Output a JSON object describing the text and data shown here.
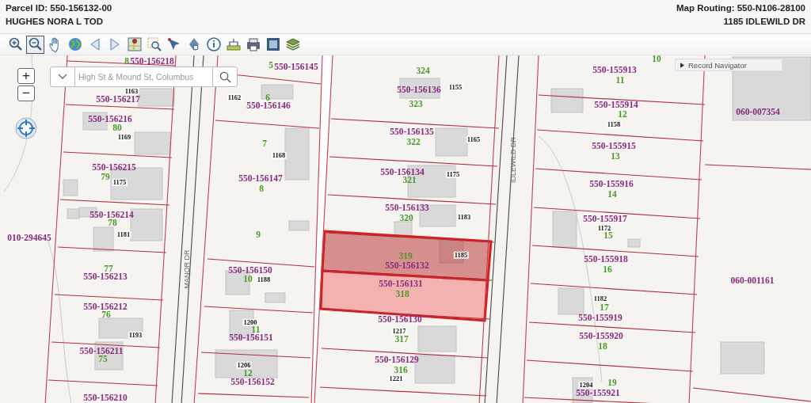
{
  "header": {
    "parcel_id": "Parcel ID: 550-156132-00",
    "owner": "HUGHES NORA L TOD",
    "map_routing": "Map Routing: 550-N106-28100",
    "address": "1185 IDLEWILD DR"
  },
  "toolbar": {
    "tools": [
      {
        "kind": "zoom-in",
        "selected": false
      },
      {
        "kind": "zoom-out",
        "selected": true
      },
      {
        "kind": "pan",
        "selected": false
      },
      {
        "kind": "globe",
        "selected": false
      },
      {
        "kind": "back",
        "selected": false
      },
      {
        "kind": "forward",
        "selected": false
      },
      {
        "kind": "map-pin",
        "selected": false
      },
      {
        "kind": "zoom-box",
        "selected": false
      },
      {
        "kind": "select",
        "selected": false
      },
      {
        "kind": "identify",
        "selected": false
      },
      {
        "kind": "info",
        "selected": false
      },
      {
        "kind": "measure",
        "selected": false
      },
      {
        "kind": "print",
        "selected": false
      },
      {
        "kind": "frame",
        "selected": false
      },
      {
        "kind": "layers",
        "selected": false
      }
    ]
  },
  "search": {
    "placeholder": "High St & Mound St, Columbus"
  },
  "zoom_controls": {
    "zoom_in": "+",
    "zoom_out": "−"
  },
  "record_navigator": {
    "label": "Record Navigator"
  },
  "map": {
    "labels": [
      {
        "kind": "lot",
        "text": "8"
      },
      {
        "kind": "parcel",
        "text": "550-156218"
      },
      {
        "kind": "lot",
        "text": "5"
      },
      {
        "kind": "parcel",
        "text": "550-156145"
      },
      {
        "kind": "house",
        "text": "1163"
      },
      {
        "kind": "parcel",
        "text": "550-156217"
      },
      {
        "kind": "house",
        "text": "1162"
      },
      {
        "kind": "lot",
        "text": "6"
      },
      {
        "kind": "parcel",
        "text": "550-156146"
      },
      {
        "kind": "parcel",
        "text": "550-156216"
      },
      {
        "kind": "lot",
        "text": "80"
      },
      {
        "kind": "house",
        "text": "1169"
      },
      {
        "kind": "lot",
        "text": "7"
      },
      {
        "kind": "house",
        "text": "1168"
      },
      {
        "kind": "parcel",
        "text": "550-156215"
      },
      {
        "kind": "lot",
        "text": "79"
      },
      {
        "kind": "house",
        "text": "1175"
      },
      {
        "kind": "parcel",
        "text": "550-156147"
      },
      {
        "kind": "lot",
        "text": "8"
      },
      {
        "kind": "parcel",
        "text": "550-156214"
      },
      {
        "kind": "lot",
        "text": "78"
      },
      {
        "kind": "house",
        "text": "1181"
      },
      {
        "kind": "parcel",
        "text": "010-294645"
      },
      {
        "kind": "lot",
        "text": "9"
      },
      {
        "kind": "lot",
        "text": "77"
      },
      {
        "kind": "parcel",
        "text": "550-156213"
      },
      {
        "kind": "parcel",
        "text": "550-156150"
      },
      {
        "kind": "lot",
        "text": "10"
      },
      {
        "kind": "house",
        "text": "1188"
      },
      {
        "kind": "parcel",
        "text": "550-156212"
      },
      {
        "kind": "lot",
        "text": "76"
      },
      {
        "kind": "house",
        "text": "1193"
      },
      {
        "kind": "house",
        "text": "1200"
      },
      {
        "kind": "lot",
        "text": "11"
      },
      {
        "kind": "parcel",
        "text": "550-156151"
      },
      {
        "kind": "parcel",
        "text": "550-156211"
      },
      {
        "kind": "lot",
        "text": "75"
      },
      {
        "kind": "house",
        "text": "1206"
      },
      {
        "kind": "lot",
        "text": "12"
      },
      {
        "kind": "parcel",
        "text": "550-156152"
      },
      {
        "kind": "parcel",
        "text": "550-156210"
      },
      {
        "kind": "street",
        "text": "MANOR DR"
      },
      {
        "kind": "lot",
        "text": "324"
      },
      {
        "kind": "parcel",
        "text": "550-156136"
      },
      {
        "kind": "house",
        "text": "1155"
      },
      {
        "kind": "lot",
        "text": "323"
      },
      {
        "kind": "parcel",
        "text": "550-156135"
      },
      {
        "kind": "lot",
        "text": "322"
      },
      {
        "kind": "house",
        "text": "1165"
      },
      {
        "kind": "parcel",
        "text": "550-156134"
      },
      {
        "kind": "lot",
        "text": "321"
      },
      {
        "kind": "house",
        "text": "1175"
      },
      {
        "kind": "parcel",
        "text": "550-156133"
      },
      {
        "kind": "lot",
        "text": "320"
      },
      {
        "kind": "house",
        "text": "1183"
      },
      {
        "kind": "lot",
        "text": "319"
      },
      {
        "kind": "parcel",
        "text": "550-156132"
      },
      {
        "kind": "house",
        "text": "1185"
      },
      {
        "kind": "parcel",
        "text": "550-156131"
      },
      {
        "kind": "lot",
        "text": "318"
      },
      {
        "kind": "parcel",
        "text": "550-156130"
      },
      {
        "kind": "house",
        "text": "1217"
      },
      {
        "kind": "lot",
        "text": "317"
      },
      {
        "kind": "parcel",
        "text": "550-156129"
      },
      {
        "kind": "lot",
        "text": "316"
      },
      {
        "kind": "house",
        "text": "1221"
      },
      {
        "kind": "street",
        "text": "IDLEWILD DR"
      },
      {
        "kind": "lot",
        "text": "10"
      },
      {
        "kind": "parcel",
        "text": "550-155913"
      },
      {
        "kind": "lot",
        "text": "11"
      },
      {
        "kind": "parcel",
        "text": "550-155914"
      },
      {
        "kind": "lot",
        "text": "12"
      },
      {
        "kind": "house",
        "text": "1158"
      },
      {
        "kind": "parcel",
        "text": "550-155915"
      },
      {
        "kind": "lot",
        "text": "13"
      },
      {
        "kind": "parcel",
        "text": "550-155916"
      },
      {
        "kind": "lot",
        "text": "14"
      },
      {
        "kind": "parcel",
        "text": "550-155917"
      },
      {
        "kind": "house",
        "text": "1172"
      },
      {
        "kind": "lot",
        "text": "15"
      },
      {
        "kind": "parcel",
        "text": "550-155918"
      },
      {
        "kind": "lot",
        "text": "16"
      },
      {
        "kind": "house",
        "text": "1182"
      },
      {
        "kind": "lot",
        "text": "17"
      },
      {
        "kind": "parcel",
        "text": "550-155919"
      },
      {
        "kind": "parcel",
        "text": "550-155920"
      },
      {
        "kind": "lot",
        "text": "18"
      },
      {
        "kind": "house",
        "text": "1204"
      },
      {
        "kind": "lot",
        "text": "19"
      },
      {
        "kind": "parcel",
        "text": "550-155921"
      },
      {
        "kind": "parcel",
        "text": "060-007354"
      },
      {
        "kind": "parcel",
        "text": "060-001161"
      }
    ]
  }
}
